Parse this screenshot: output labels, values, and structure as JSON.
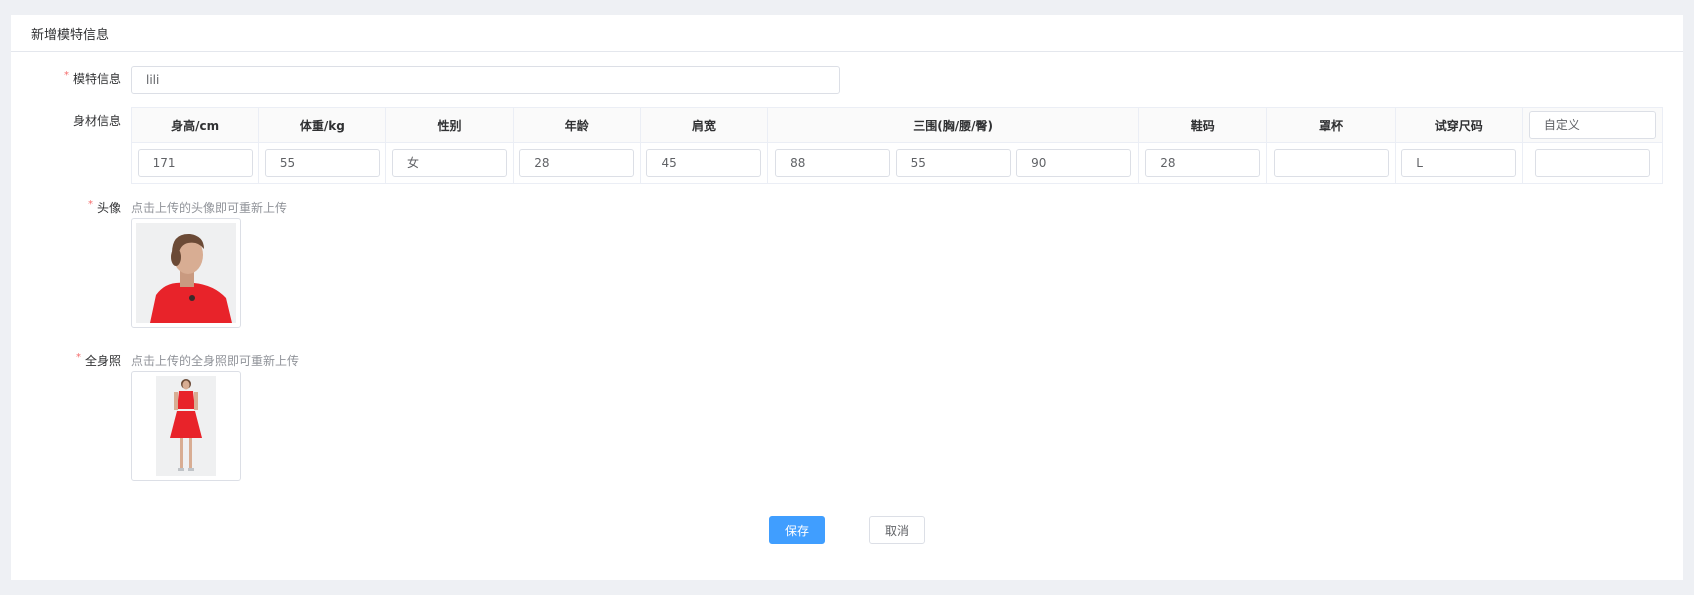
{
  "header": {
    "title": "新增模特信息"
  },
  "form": {
    "model_info": {
      "label": "模特信息",
      "required_mark": "*",
      "value": "lili"
    },
    "body_info": {
      "label": "身材信息",
      "headers": [
        "身高/cm",
        "体重/kg",
        "性别",
        "年龄",
        "肩宽",
        "三围(胸/腰/臀)",
        "鞋码",
        "罩杯",
        "试穿尺码"
      ],
      "custom_header": "自定义",
      "values": {
        "height": "171",
        "weight": "55",
        "gender": "女",
        "age": "28",
        "shoulder": "45",
        "bust": "88",
        "waist": "55",
        "hip": "90",
        "shoe": "28",
        "cup": "",
        "trial_size": "L",
        "custom": ""
      }
    },
    "avatar": {
      "label": "头像",
      "required_mark": "*",
      "hint": "点击上传的头像即可重新上传"
    },
    "full_body": {
      "label": "全身照",
      "required_mark": "*",
      "hint": "点击上传的全身照即可重新上传"
    }
  },
  "actions": {
    "save": "保存",
    "cancel": "取消"
  },
  "colors": {
    "primary": "#409eff",
    "required": "#f56c6c",
    "dress": "#e8232a"
  }
}
